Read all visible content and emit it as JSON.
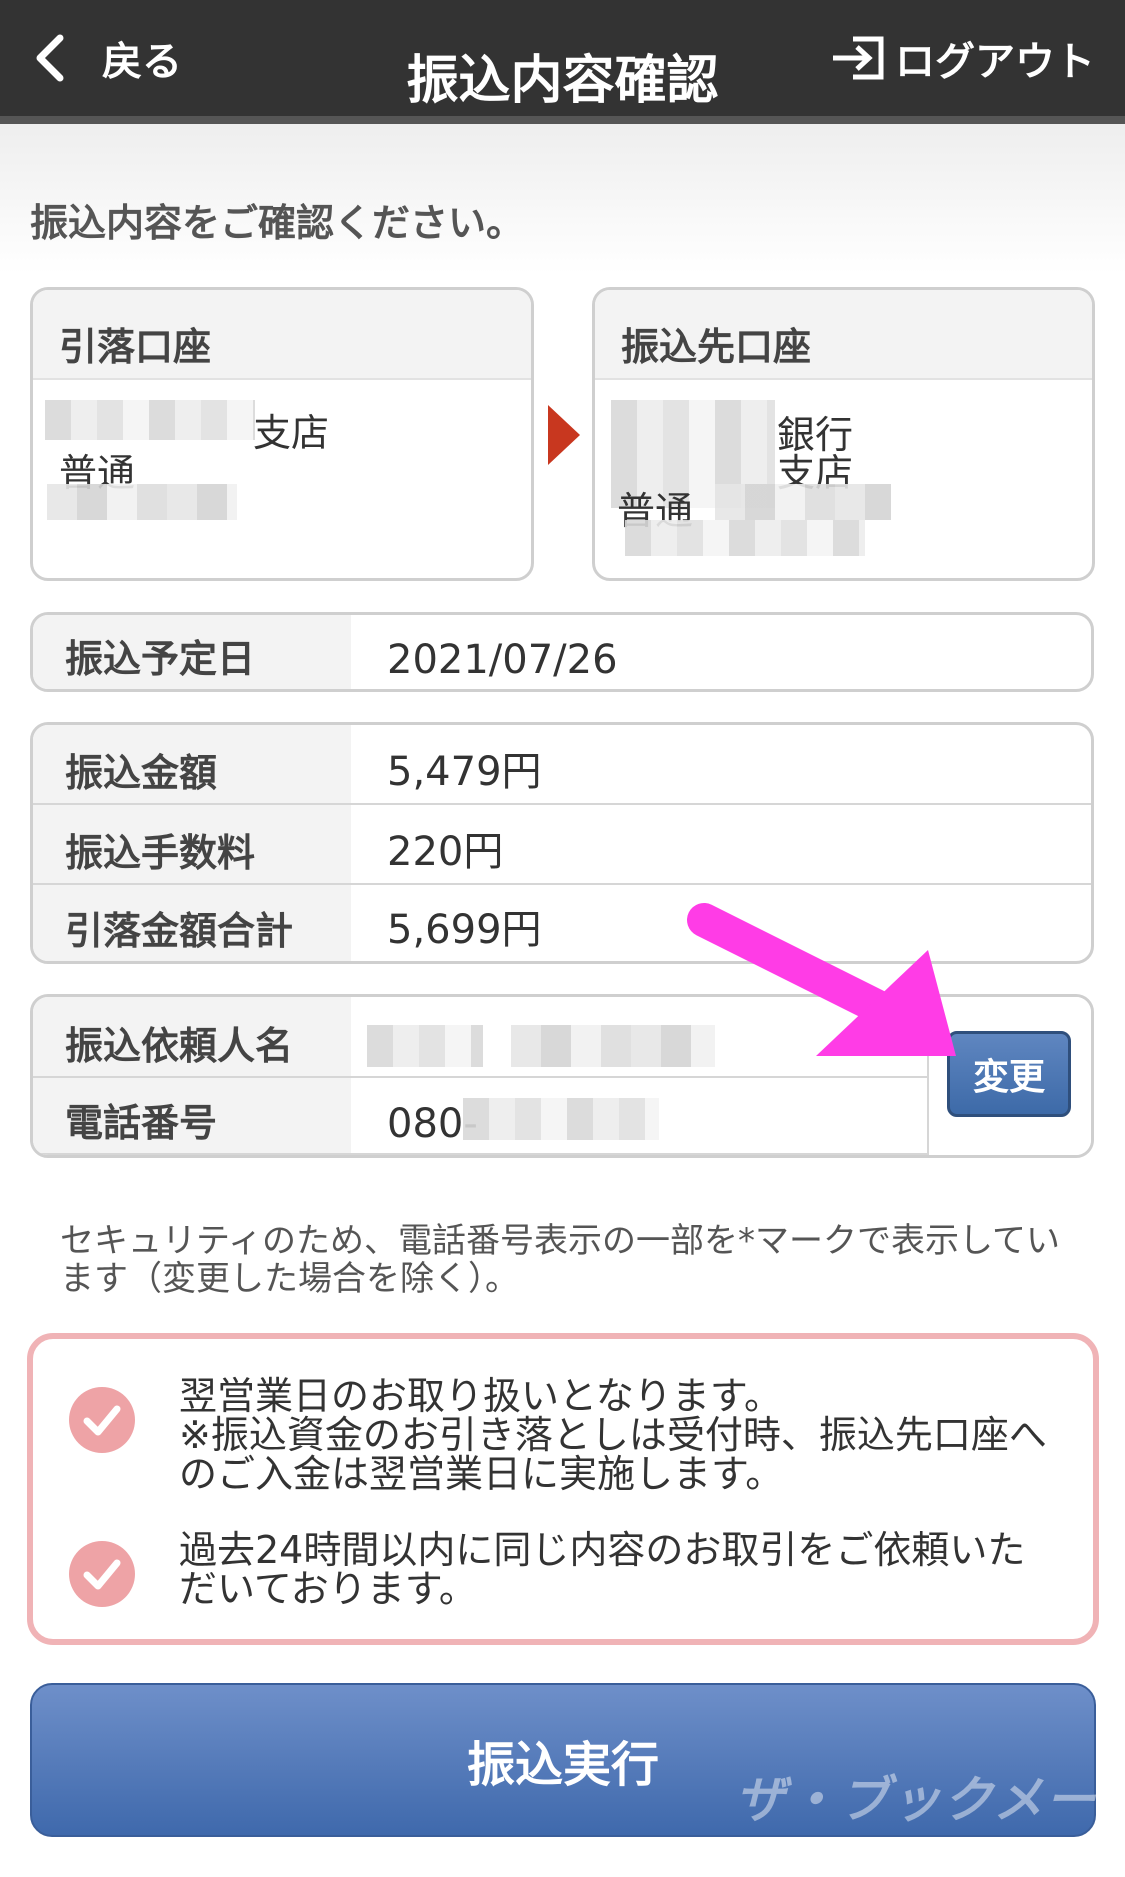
{
  "header": {
    "back_label": "戻る",
    "title": "振込内容確認",
    "logout_label": "ログアウト"
  },
  "intro": "振込内容をご確認ください。",
  "from_account": {
    "heading": "引落口座",
    "branch_suffix": "支店",
    "type": "普通"
  },
  "to_account": {
    "heading": "振込先口座",
    "bank_suffix": "銀行",
    "branch_suffix": "支店",
    "type": "普通"
  },
  "schedule": {
    "label": "振込予定日",
    "value": "2021/07/26"
  },
  "amounts": [
    {
      "label": "振込金額",
      "value": "5,479円"
    },
    {
      "label": "振込手数料",
      "value": "220円"
    },
    {
      "label": "引落金額合計",
      "value": "5,699円"
    }
  ],
  "requester": {
    "name_label": "振込依頼人名",
    "phone_label": "電話番号",
    "phone_prefix": "080-",
    "change_label": "変更"
  },
  "security_note": "セキュリティのため、電話番号表示の一部を*マークで表示しています（変更した場合を除く）。",
  "notices": [
    "翌営業日のお取り扱いとなります。\n※振込資金のお引き落としは受付時、振込先口座へのご入金は翌営業日に実施します。",
    "過去24時間以内に同じ内容のお取引をご依頼いただいております。"
  ],
  "execute_label": "振込実行",
  "watermark": "ザ・ブックメーカーズ",
  "colors": {
    "header_bg": "#333333",
    "accent_red": "#c8371f",
    "notice_border": "#f0b3b6",
    "button_blue": "#3f69ac",
    "annotation_arrow": "#ff3ce6"
  }
}
